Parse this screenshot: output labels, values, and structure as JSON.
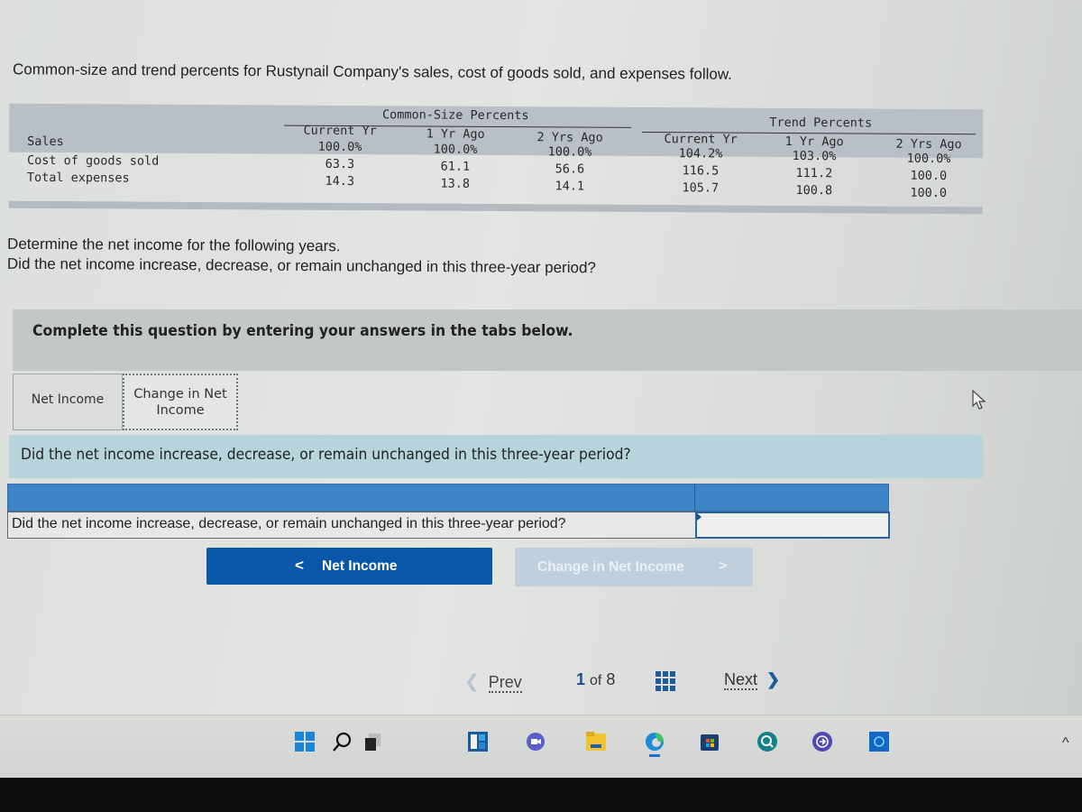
{
  "intro": "Common-size and trend percents for Rustynail Company's sales, cost of goods sold, and expenses follow.",
  "table": {
    "common_size_title": "Common-Size Percents",
    "trend_title": "Trend Percents",
    "columns": [
      "Current Yr",
      "1 Yr Ago",
      "2 Yrs Ago",
      "Current Yr",
      "1 Yr Ago",
      "2 Yrs Ago"
    ],
    "rows": [
      {
        "label": "Sales",
        "values": [
          "100.0%",
          "100.0%",
          "100.0%",
          "104.2%",
          "103.0%",
          "100.0%"
        ]
      },
      {
        "label": "Cost of goods sold",
        "values": [
          "63.3",
          "61.1",
          "56.6",
          "116.5",
          "111.2",
          "100.0"
        ]
      },
      {
        "label": "Total expenses",
        "values": [
          "14.3",
          "13.8",
          "14.1",
          "105.7",
          "100.8",
          "100.0"
        ]
      }
    ]
  },
  "question": {
    "line1": "Determine the net income for the following years.",
    "line2": "Did the net income increase, decrease, or remain unchanged in this three-year period?"
  },
  "instruction": "Complete this question by entering your answers in the tabs below.",
  "tabs": [
    {
      "label": "Net Income",
      "active": false
    },
    {
      "label_line1": "Change in Net",
      "label_line2": "Income",
      "active": true
    }
  ],
  "panel": {
    "prompt": "Did the net income increase, decrease, or remain unchanged in this three-year period?",
    "row_question": "Did the net income increase, decrease, or remain unchanged in this three-year period?",
    "answer_value": ""
  },
  "nav_buttons": {
    "prev_label": "Net Income",
    "prev_chevron": "<",
    "next_label": "Change in Net Income",
    "next_chevron": ">"
  },
  "pager": {
    "prev": "Prev",
    "current": "1",
    "of_text": "of",
    "total": "8",
    "next": "Next"
  },
  "taskbar": {
    "icons": [
      "windows-start-icon",
      "search-icon",
      "task-view-icon",
      "widgets-icon",
      "teams-chat-icon",
      "file-explorer-icon",
      "edge-browser-icon",
      "microsoft-store-icon",
      "app-search-icon",
      "app-sync-icon",
      "app-blue-icon"
    ],
    "tray_chevron": "^"
  }
}
